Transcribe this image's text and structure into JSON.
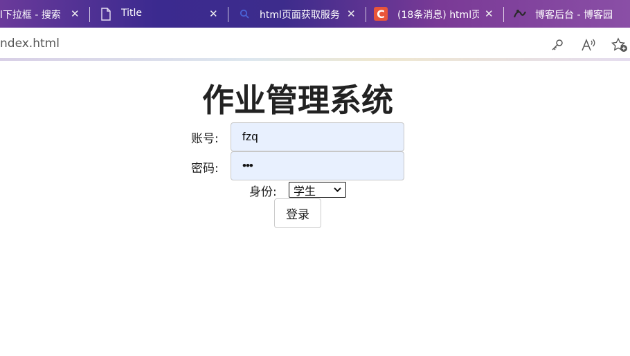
{
  "browser": {
    "tabs": [
      {
        "title": "l下拉框 - 搜索",
        "close": "✕"
      },
      {
        "title": "Title",
        "close": "✕"
      },
      {
        "title": "html页面获取服务",
        "close": "✕"
      },
      {
        "title": "(18条消息) html页",
        "icon_letter": "C",
        "close": "✕"
      },
      {
        "title": "博客后台 - 博客园",
        "close": "✕"
      }
    ],
    "url": "ndex.html",
    "colors": {
      "tabbar": "#3b2a8f",
      "csdn_red": "#e9553a"
    }
  },
  "page": {
    "heading": "作业管理系统",
    "username_label": "账号:",
    "username_value": "fzq",
    "password_label": "密码:",
    "password_value": "•••",
    "role_label": "身份:",
    "role_selected": "学生",
    "login_button": "登录",
    "field_bg": "#e8f0fe"
  }
}
